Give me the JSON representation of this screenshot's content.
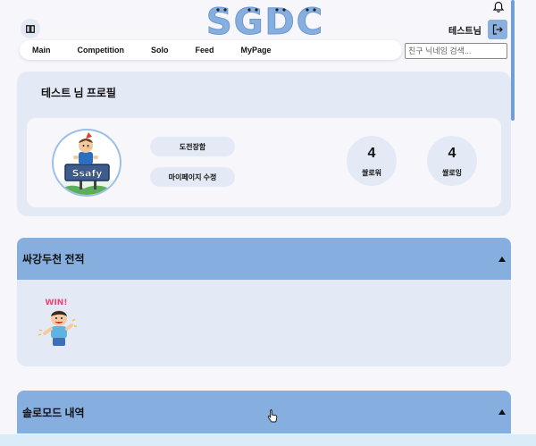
{
  "header": {
    "logo_text": "SGDC",
    "user_name": "테스트님"
  },
  "nav": {
    "items": [
      "Main",
      "Competition",
      "Solo",
      "Feed",
      "MyPage"
    ]
  },
  "search": {
    "placeholder": "친구 닉네임 검색..."
  },
  "profile": {
    "title": "테스트 님 프로필",
    "challenge_button": "도전장함",
    "edit_button": "마이페이지 수정",
    "stats": [
      {
        "value": "4",
        "label": "쌀로워"
      },
      {
        "value": "4",
        "label": "쌀로잉"
      }
    ],
    "avatar_sign_text": "Ssafy"
  },
  "sections": [
    {
      "title": "싸강두천 전적",
      "badge_text": "WIN!"
    },
    {
      "title": "솔로모드 내역"
    }
  ],
  "colors": {
    "accent": "#86afdf",
    "card": "#e3eaf5",
    "background": "#f7f6fb"
  }
}
